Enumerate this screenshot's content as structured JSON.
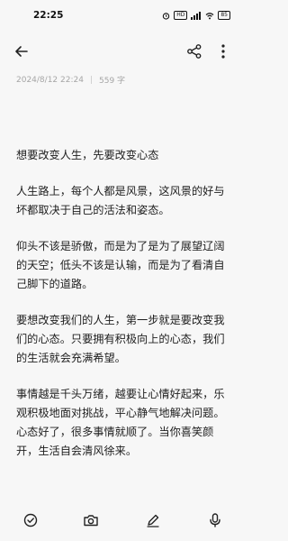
{
  "status_bar": {
    "time": "22:25",
    "icons": [
      "alarm-icon",
      "hd-icon",
      "4g-signal-icon",
      "wifi-icon",
      "battery-icon"
    ],
    "hd_label": "HD",
    "battery_level": "85"
  },
  "toolbar": {
    "back_icon": "arrow-left-icon",
    "share_icon": "share-icon",
    "more_icon": "more-vertical-icon"
  },
  "note": {
    "datetime": "2024/8/12 22:24",
    "separator": "|",
    "word_count": "559 字",
    "paragraphs": [
      "想要改变人生，先要改变心态",
      "人生路上，每个人都是风景，这风景的好与坏都取决于自己的活法和姿态。",
      "仰头不该是骄傲，而是为了是为了展望辽阔的天空；低头不该是认输，而是为了看清自己脚下的道路。",
      "要想改变我们的人生，第一步就是要改变我们的心态。只要拥有积极向上的心态，我们的生活就会充满希望。",
      "事情越是千头万绪，越要让心情好起来，乐观积极地面对挑战，平心静气地解决问题。心态好了，很多事情就顺了。当你喜笑颜开，生活自会清风徐来。"
    ]
  },
  "bottom_bar": {
    "icons": [
      "checklist-icon",
      "camera-icon",
      "pen-icon",
      "microphone-icon"
    ]
  },
  "colors": {
    "background": "#f7f7f7",
    "text": "#1e1e1e",
    "meta_text": "#a6a6a6"
  }
}
